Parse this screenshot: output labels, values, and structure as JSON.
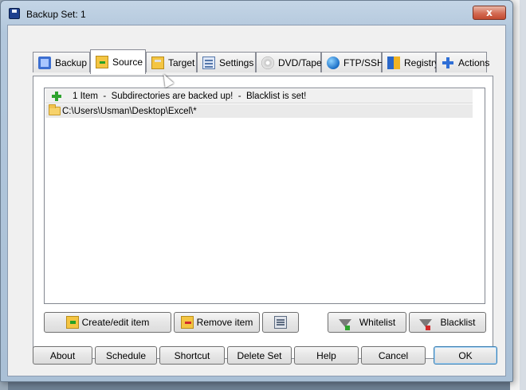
{
  "window": {
    "title": "Backup Set: 1",
    "close_label": "x"
  },
  "tabs": [
    {
      "label": "Backup",
      "icon": "backup-icon",
      "active": false
    },
    {
      "label": "Source",
      "icon": "source-folder-icon",
      "active": true
    },
    {
      "label": "Target",
      "icon": "target-folder-icon",
      "active": false
    },
    {
      "label": "Settings",
      "icon": "settings-icon",
      "active": false
    },
    {
      "label": "DVD/Tape",
      "icon": "dvd-icon",
      "active": false
    },
    {
      "label": "FTP/SSH",
      "icon": "globe-icon",
      "active": false
    },
    {
      "label": "Registry",
      "icon": "registry-icon",
      "active": false
    },
    {
      "label": "Actions",
      "icon": "plus-icon",
      "active": false
    }
  ],
  "source_list": {
    "header": "1 Item  -  Subdirectories are backed up!  -  Blacklist is set!",
    "items": [
      {
        "path": "C:\\Users\\Usman\\Desktop\\Excel\\*"
      }
    ]
  },
  "panel_buttons": {
    "create_edit": "Create/edit item",
    "remove": "Remove item",
    "whitelist": "Whitelist",
    "blacklist": "Blacklist"
  },
  "footer_buttons": {
    "about": "About",
    "schedule": "Schedule",
    "shortcut": "Shortcut",
    "delete_set": "Delete Set",
    "help": "Help",
    "cancel": "Cancel",
    "ok": "OK"
  },
  "colors": {
    "header_plus": "#2ea32e",
    "window_frame": "#b2c7dc",
    "close_button": "#c24a30"
  }
}
